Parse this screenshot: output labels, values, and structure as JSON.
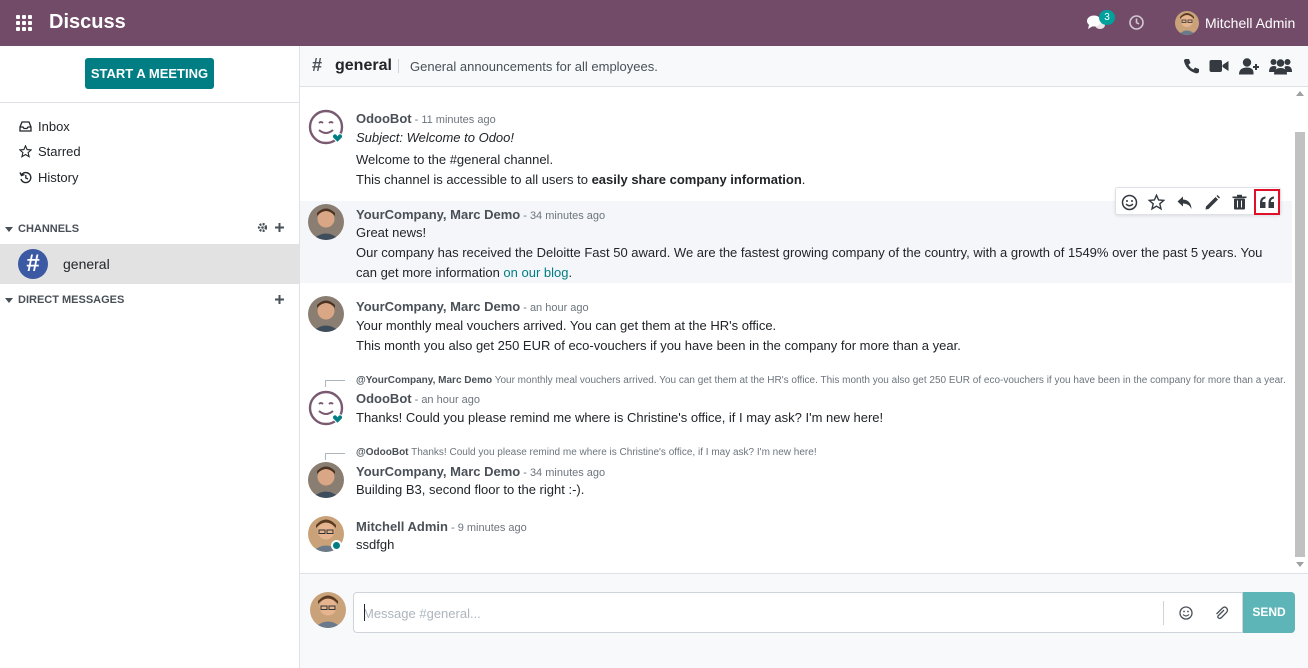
{
  "navbar": {
    "app_title": "Discuss",
    "chat_badge": "3",
    "user_name": "Mitchell Admin",
    "icons": [
      "apps-icon",
      "chat-icon",
      "clock-icon",
      "avatar"
    ]
  },
  "sidebar": {
    "start_meeting": "START A MEETING",
    "mailboxes": [
      {
        "label": "Inbox",
        "icon": "inbox-icon"
      },
      {
        "label": "Starred",
        "icon": "star-icon"
      },
      {
        "label": "History",
        "icon": "history-icon"
      }
    ],
    "channels_header": "CHANNELS",
    "channel": {
      "label": "general"
    },
    "direct_messages_header": "DIRECT MESSAGES"
  },
  "thread": {
    "name": "general",
    "description": "General announcements for all employees.",
    "header_icons": [
      "phone-icon",
      "video-icon",
      "add-user-icon",
      "members-icon"
    ]
  },
  "messages": [
    {
      "author": "OdooBot",
      "date": "- 11 minutes ago",
      "subject": "Subject: Welcome to Odoo!",
      "line1": "Welcome to the #general channel.",
      "line2_prefix": "This channel is accessible to all users to ",
      "line2_bold": "easily share company information",
      "line2_suffix": "."
    },
    {
      "author": "YourCompany, Marc Demo",
      "date": "- 34 minutes ago",
      "line1": "Great news!",
      "line2": "Our company has received the Deloitte Fast 50 award. We are the fastest growing company of the country, with a growth of 1549% over the past 5 years. You",
      "line3_prefix": "can get more information ",
      "line3_link": "on our blog",
      "line3_suffix": "."
    },
    {
      "author": "YourCompany, Marc Demo",
      "date": "- an hour ago",
      "line1": "Your monthly meal vouchers arrived. You can get them at the HR's office.",
      "line2": "This month you also get 250 EUR of eco-vouchers if you have been in the company for more than a year."
    },
    {
      "reply_author": "@YourCompany, Marc Demo",
      "reply_text": "Your monthly meal vouchers arrived. You can get them at the HR's office. This month you also get 250 EUR of eco-vouchers if you have been in the company for more than a year.",
      "author": "OdooBot",
      "date": "- an hour ago",
      "line1": "Thanks! Could you please remind me where is Christine's office, if I may ask? I'm new here!"
    },
    {
      "reply_author": "@OdooBot",
      "reply_text": "Thanks! Could you please remind me where is Christine's office, if I may ask? I'm new here!",
      "author": "YourCompany, Marc Demo",
      "date": "- 34 minutes ago",
      "line1": "Building B3, second floor to the right :-)."
    },
    {
      "author": "Mitchell Admin",
      "date": "- 9 minutes ago",
      "line1": "ssdfgh"
    }
  ],
  "message_actions": [
    "emoji-icon",
    "star-icon",
    "reply-icon",
    "edit-icon",
    "delete-icon",
    "quote-icon"
  ],
  "composer": {
    "placeholder": "Message #general...",
    "send_label": "SEND"
  },
  "colors": {
    "brand": "#714b67",
    "accent": "#017e84",
    "channel_avatar": "#3c59a4",
    "highlight_outline": "#e0102a"
  }
}
